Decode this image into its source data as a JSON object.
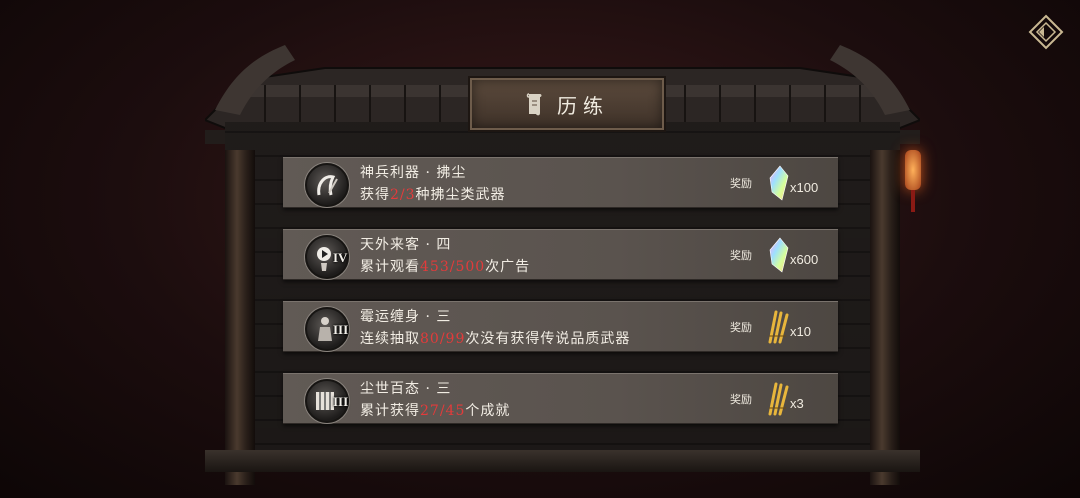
{
  "header": {
    "title": "历练",
    "title_icon": "scroll-icon"
  },
  "corner_button": {
    "icon": "diamond-back-icon"
  },
  "tasks": [
    {
      "name": "神兵利器 · 拂尘",
      "desc_prefix": "获得",
      "progress": "2/3",
      "desc_suffix": "种拂尘类武器",
      "tier": "",
      "icon": "whisk-icon",
      "reward_label": "奖励",
      "reward_icon": "crystal-icon",
      "reward_count": "x100"
    },
    {
      "name": "天外来客 · 四",
      "desc_prefix": "累计观看",
      "progress": "453/500",
      "desc_suffix": "次广告",
      "tier": "IV",
      "icon": "video-play-icon",
      "reward_label": "奖励",
      "reward_icon": "crystal-icon",
      "reward_count": "x600"
    },
    {
      "name": "霉运缠身 · 三",
      "desc_prefix": "连续抽取",
      "progress": "80/99",
      "desc_suffix": "次没有获得传说品质武器",
      "tier": "III",
      "icon": "figure-icon",
      "reward_label": "奖励",
      "reward_icon": "golden-sticks-icon",
      "reward_count": "x10"
    },
    {
      "name": "尘世百态 · 三",
      "desc_prefix": "累计获得",
      "progress": "27/45",
      "desc_suffix": "个成就",
      "tier": "III",
      "icon": "achievement-icon",
      "reward_label": "奖励",
      "reward_icon": "golden-sticks-icon",
      "reward_count": "x3"
    }
  ],
  "colors": {
    "progress": "#e23b3b",
    "panel": "#5a534e",
    "text": "#f2ede4"
  }
}
